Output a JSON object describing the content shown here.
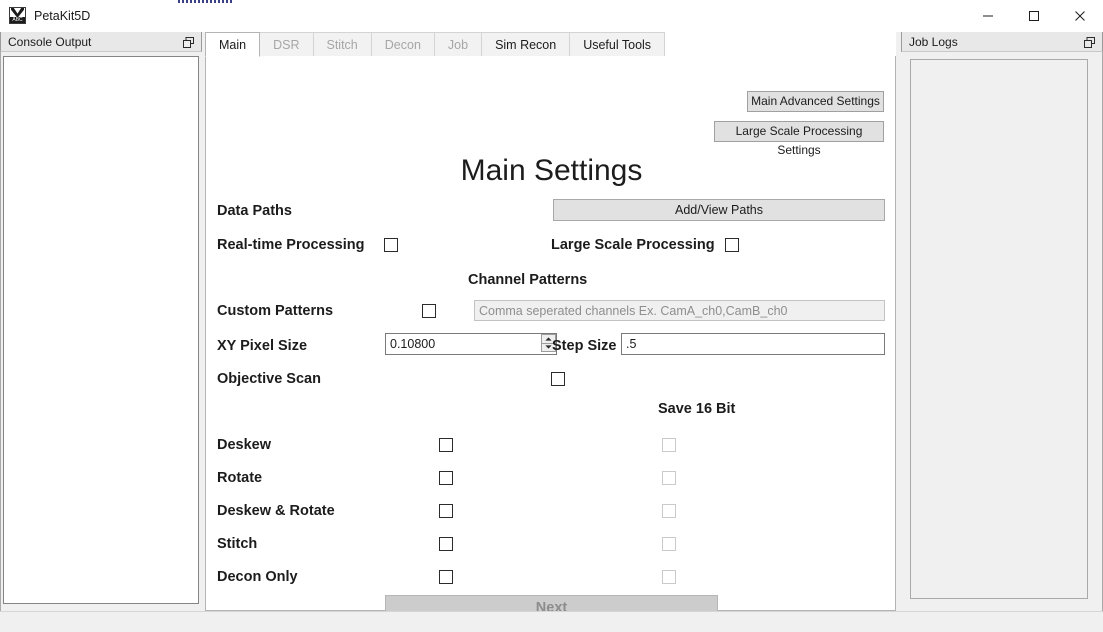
{
  "window": {
    "title": "PetaKit5D",
    "icon": "app-icon",
    "minimize_label": "—",
    "maximize_label": "□",
    "close_label": "✕"
  },
  "left_dock": {
    "title": "Console Output",
    "undock_icon": "undock-icon",
    "content": ""
  },
  "right_dock": {
    "title": "Job Logs",
    "undock_icon": "undock-icon",
    "content": "",
    "scroll_up_icon": "chevron-up-icon",
    "scroll_down_icon": "chevron-down-icon"
  },
  "tabs": [
    {
      "label": "Main",
      "active": true,
      "enabled": true
    },
    {
      "label": "DSR",
      "active": false,
      "enabled": false
    },
    {
      "label": "Stitch",
      "active": false,
      "enabled": false
    },
    {
      "label": "Decon",
      "active": false,
      "enabled": false
    },
    {
      "label": "Job",
      "active": false,
      "enabled": false
    },
    {
      "label": "Sim Recon",
      "active": false,
      "enabled": true
    },
    {
      "label": "Useful Tools",
      "active": false,
      "enabled": true
    }
  ],
  "main": {
    "advanced_button": "Main Advanced Settings",
    "large_scale_button": "Large Scale Processing Settings",
    "heading": "Main Settings",
    "data_paths_label": "Data Paths",
    "add_view_paths_button": "Add/View Paths",
    "realtime_label": "Real-time Processing",
    "large_scale_label": "Large Scale Processing",
    "channel_patterns_header": "Channel Patterns",
    "custom_patterns_label": "Custom Patterns",
    "channel_patterns_placeholder": "Comma seperated channels Ex. CamA_ch0,CamB_ch0",
    "channel_patterns_value": "",
    "xy_pixel_size_label": "XY Pixel Size",
    "xy_pixel_size_value": "0.10800",
    "step_size_label": "Step Size",
    "step_size_value": ".5",
    "objective_scan_label": "Objective Scan",
    "save16bit_header": "Save 16 Bit",
    "operations": [
      {
        "label": "Deskew",
        "checked": false,
        "save16bit_enabled": false
      },
      {
        "label": "Rotate",
        "checked": false,
        "save16bit_enabled": false
      },
      {
        "label": "Deskew & Rotate",
        "checked": false,
        "save16bit_enabled": false
      },
      {
        "label": "Stitch",
        "checked": false,
        "save16bit_enabled": false
      },
      {
        "label": "Decon Only",
        "checked": false,
        "save16bit_enabled": false
      }
    ],
    "next_button": "Next"
  },
  "colors": {
    "window_bg": "#f0f0f0",
    "panel_bg": "#ffffff",
    "button_face": "#e1e1e1",
    "disabled_text": "#8c8c8c",
    "inactive_tab_text": "#a6a6a6",
    "border": "#a9a9a9",
    "accent": "#3b3f87"
  }
}
